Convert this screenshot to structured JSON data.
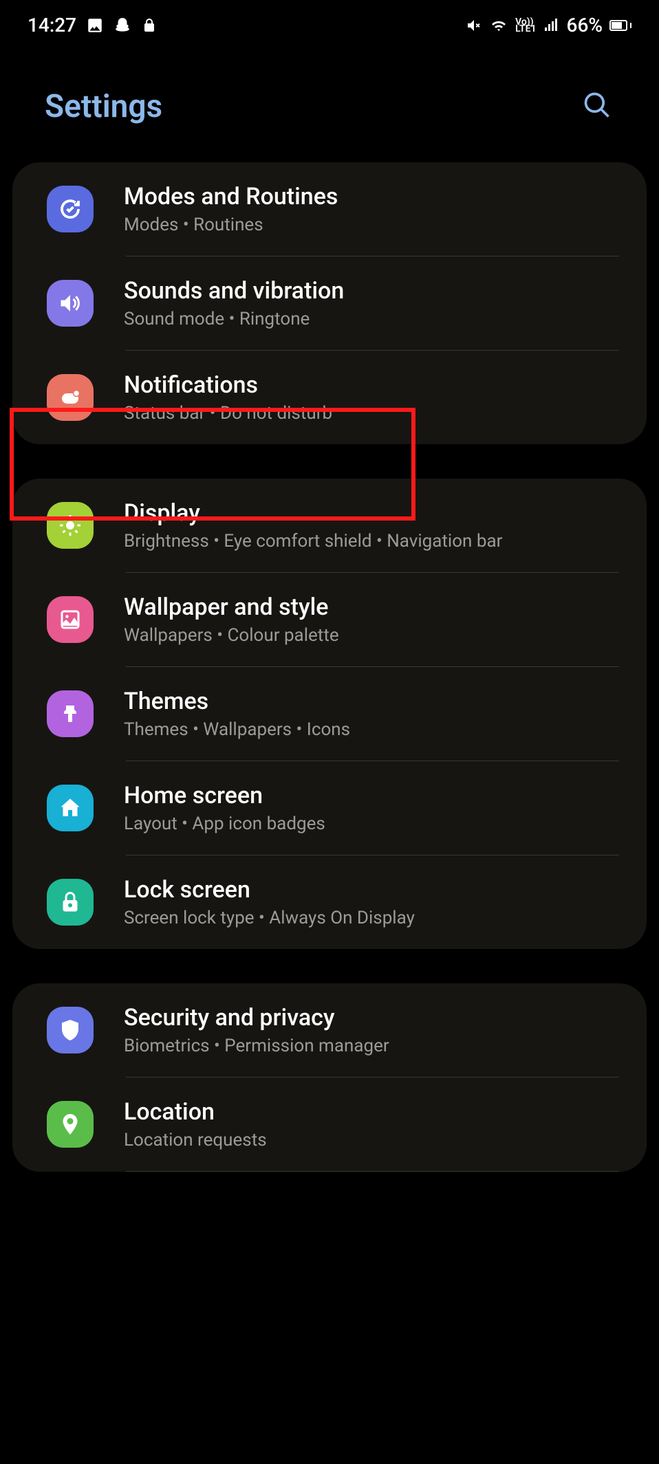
{
  "statusBar": {
    "time": "14:27",
    "battery": "66%"
  },
  "header": {
    "title": "Settings"
  },
  "groups": [
    {
      "items": [
        {
          "id": "modes",
          "title": "Modes and Routines",
          "sub": "Modes  •  Routines",
          "iconColor": "bg-blue",
          "icon": "modes"
        },
        {
          "id": "sounds",
          "title": "Sounds and vibration",
          "sub": "Sound mode  •  Ringtone",
          "iconColor": "bg-purple",
          "icon": "sound"
        },
        {
          "id": "notifications",
          "title": "Notifications",
          "sub": "Status bar  •  Do not disturb",
          "iconColor": "bg-coral",
          "icon": "notif"
        }
      ]
    },
    {
      "items": [
        {
          "id": "display",
          "title": "Display",
          "sub": "Brightness  •  Eye comfort shield  •  Navigation bar",
          "iconColor": "bg-green",
          "icon": "display"
        },
        {
          "id": "wallpaper",
          "title": "Wallpaper and style",
          "sub": "Wallpapers  •  Colour palette",
          "iconColor": "bg-pink",
          "icon": "wallpaper"
        },
        {
          "id": "themes",
          "title": "Themes",
          "sub": "Themes  •  Wallpapers  •  Icons",
          "iconColor": "bg-violet",
          "icon": "themes"
        },
        {
          "id": "home",
          "title": "Home screen",
          "sub": "Layout  •  App icon badges",
          "iconColor": "bg-cyan",
          "icon": "home"
        },
        {
          "id": "lock",
          "title": "Lock screen",
          "sub": "Screen lock type  •  Always On Display",
          "iconColor": "bg-teal",
          "icon": "lock"
        }
      ]
    },
    {
      "items": [
        {
          "id": "security",
          "title": "Security and privacy",
          "sub": "Biometrics  •  Permission manager",
          "iconColor": "bg-navy",
          "icon": "security"
        },
        {
          "id": "location",
          "title": "Location",
          "sub": "Location requests",
          "iconColor": "bg-lime",
          "icon": "location"
        }
      ]
    }
  ]
}
